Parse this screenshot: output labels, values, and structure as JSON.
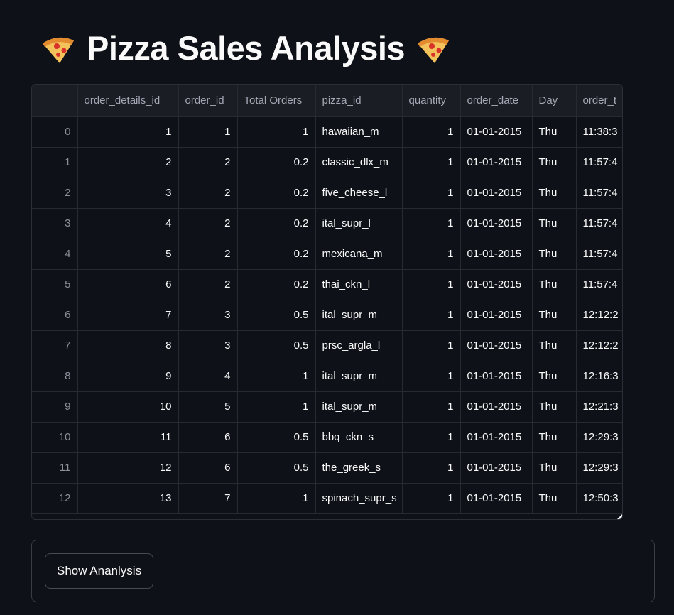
{
  "header": {
    "title": "Pizza Sales Analysis",
    "left_icon": "pizza-icon",
    "right_icon": "pizza-icon"
  },
  "table": {
    "columns": [
      "",
      "order_details_id",
      "order_id",
      "Total Orders",
      "pizza_id",
      "quantity",
      "order_date",
      "Day",
      "order_t"
    ],
    "rows": [
      [
        "0",
        "1",
        "1",
        "1",
        "hawaiian_m",
        "1",
        "01-01-2015",
        "Thu",
        "11:38:3"
      ],
      [
        "1",
        "2",
        "2",
        "0.2",
        "classic_dlx_m",
        "1",
        "01-01-2015",
        "Thu",
        "11:57:4"
      ],
      [
        "2",
        "3",
        "2",
        "0.2",
        "five_cheese_l",
        "1",
        "01-01-2015",
        "Thu",
        "11:57:4"
      ],
      [
        "3",
        "4",
        "2",
        "0.2",
        "ital_supr_l",
        "1",
        "01-01-2015",
        "Thu",
        "11:57:4"
      ],
      [
        "4",
        "5",
        "2",
        "0.2",
        "mexicana_m",
        "1",
        "01-01-2015",
        "Thu",
        "11:57:4"
      ],
      [
        "5",
        "6",
        "2",
        "0.2",
        "thai_ckn_l",
        "1",
        "01-01-2015",
        "Thu",
        "11:57:4"
      ],
      [
        "6",
        "7",
        "3",
        "0.5",
        "ital_supr_m",
        "1",
        "01-01-2015",
        "Thu",
        "12:12:2"
      ],
      [
        "7",
        "8",
        "3",
        "0.5",
        "prsc_argla_l",
        "1",
        "01-01-2015",
        "Thu",
        "12:12:2"
      ],
      [
        "8",
        "9",
        "4",
        "1",
        "ital_supr_m",
        "1",
        "01-01-2015",
        "Thu",
        "12:16:3"
      ],
      [
        "9",
        "10",
        "5",
        "1",
        "ital_supr_m",
        "1",
        "01-01-2015",
        "Thu",
        "12:21:3"
      ],
      [
        "10",
        "11",
        "6",
        "0.5",
        "bbq_ckn_s",
        "1",
        "01-01-2015",
        "Thu",
        "12:29:3"
      ],
      [
        "11",
        "12",
        "6",
        "0.5",
        "the_greek_s",
        "1",
        "01-01-2015",
        "Thu",
        "12:29:3"
      ],
      [
        "12",
        "13",
        "7",
        "1",
        "spinach_supr_s",
        "1",
        "01-01-2015",
        "Thu",
        "12:50:3"
      ]
    ]
  },
  "form": {
    "button_label": "Show Ananlysis"
  },
  "colors": {
    "background": "#0e1117",
    "header_bg": "#1a1d24",
    "border": "#262a33",
    "text": "#fafafa",
    "muted_text": "#8b909b"
  }
}
